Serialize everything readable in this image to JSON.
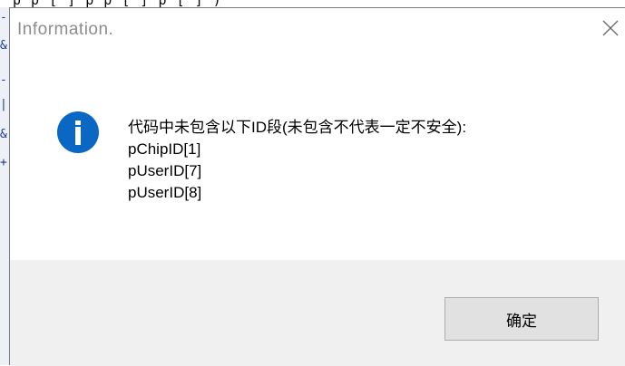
{
  "background_editor": {
    "top_text": "p  p  [ ]  p  p  [ ]  p  [  ]  ) ",
    "left_glyphs": [
      "-",
      "&",
      "-",
      "|",
      "&",
      "+"
    ]
  },
  "dialog": {
    "title": "Information.",
    "close_icon": "close-icon",
    "icon": "info-icon",
    "icon_color": "#0a68c4",
    "message_lines": [
      "代码中未包含以下ID段(未包含不代表一定不安全):",
      "pChipID[1]",
      "pUserID[7]",
      "pUserID[8]"
    ],
    "ok_label": "确定"
  }
}
